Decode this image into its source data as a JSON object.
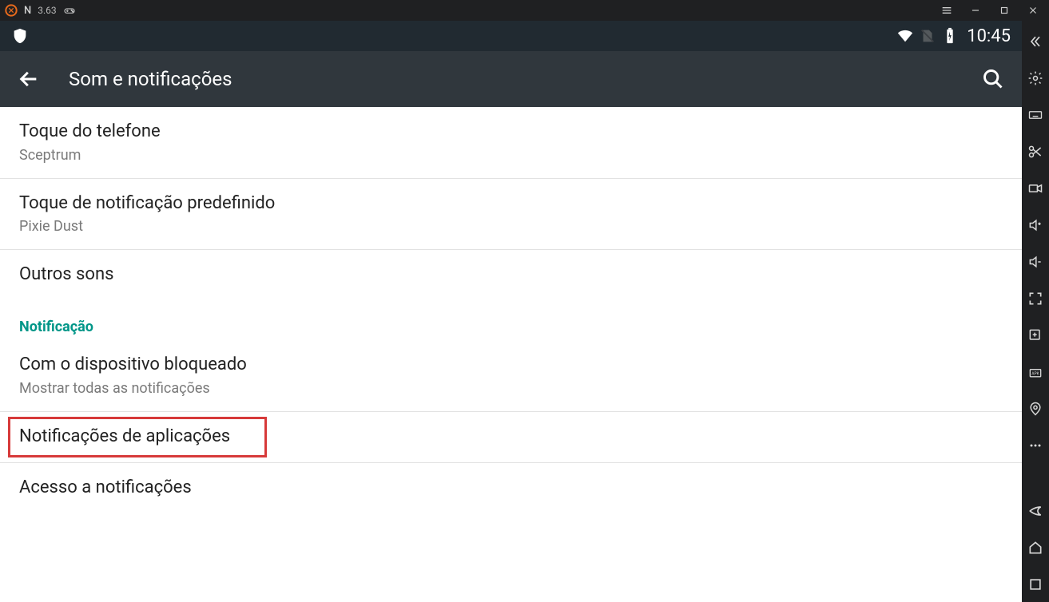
{
  "emulator": {
    "name_letter": "N",
    "version": "3.63"
  },
  "android_status": {
    "clock": "10:45"
  },
  "appbar": {
    "title": "Som e notificações"
  },
  "settings": {
    "phone_ringtone": {
      "title": "Toque do telefone",
      "value": "Sceptrum"
    },
    "notification_ringtone": {
      "title": "Toque de notificação predefinido",
      "value": "Pixie Dust"
    },
    "other_sounds": {
      "title": "Outros sons"
    },
    "section_notification": "Notificação",
    "device_locked": {
      "title": "Com o dispositivo bloqueado",
      "value": "Mostrar todas as notificações"
    },
    "app_notifications": {
      "title": "Notificações de aplicações"
    },
    "notification_access": {
      "title": "Acesso a notificações"
    }
  }
}
